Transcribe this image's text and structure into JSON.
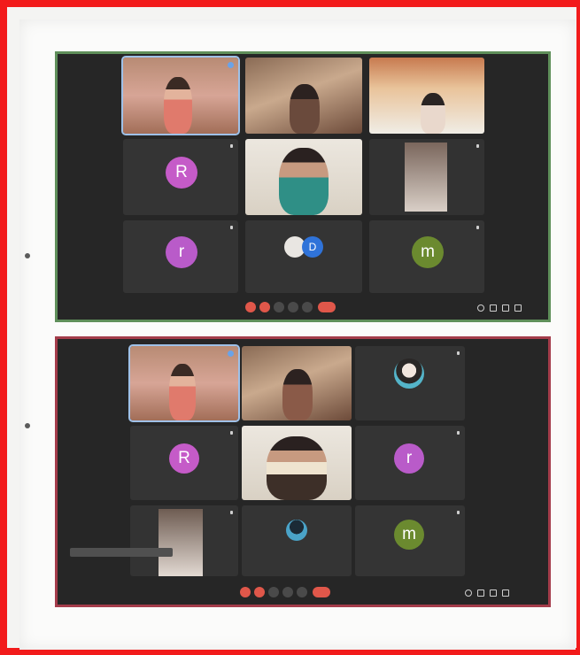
{
  "screenshots": [
    {
      "id": "top",
      "tiles": [
        {
          "name": "",
          "kind": "video-pink",
          "active": true
        },
        {
          "name": "",
          "kind": "video-warm"
        },
        {
          "name": "",
          "kind": "video-banner"
        },
        {
          "name": "",
          "kind": "avatar",
          "letter": "R",
          "color": "#c55bc8"
        },
        {
          "name": "",
          "kind": "video-light"
        },
        {
          "name": "",
          "kind": "video-grey"
        },
        {
          "name": "",
          "kind": "avatar",
          "letter": "r",
          "color": "#b95bc9"
        },
        {
          "name": "",
          "kind": "pair",
          "letter": "D",
          "color": "#2f73d9"
        },
        {
          "name": "",
          "kind": "avatar",
          "letter": "m",
          "color": "#6b8a2f"
        }
      ],
      "bar": {
        "time": "",
        "code": ""
      }
    },
    {
      "id": "bottom",
      "tiles": [
        {
          "name": "",
          "kind": "video-pink",
          "active": true
        },
        {
          "name": "",
          "kind": "video-warm"
        },
        {
          "name": "",
          "kind": "portrait"
        },
        {
          "name": "",
          "kind": "avatar",
          "letter": "R",
          "color": "#c55bc8"
        },
        {
          "name": "",
          "kind": "video-light"
        },
        {
          "name": "",
          "kind": "avatar",
          "letter": "r",
          "color": "#b95bc9"
        },
        {
          "name": "",
          "kind": "video-grey"
        },
        {
          "name": "",
          "kind": "portrait-small"
        },
        {
          "name": "",
          "kind": "avatar",
          "letter": "m",
          "color": "#6b8a2f"
        }
      ],
      "bar": {
        "time": "",
        "code": ""
      },
      "tooltip": ""
    }
  ],
  "colors": {
    "frame": "#f21b1b",
    "top_border": "#5f8f5a",
    "bottom_border": "#a43c4a",
    "meeting_bg": "#262626",
    "end_call": "#e0574a"
  },
  "icons": [
    "mic-icon",
    "camera-icon",
    "captions-icon",
    "present-icon",
    "more-icon",
    "end-call-icon",
    "info-icon",
    "people-icon",
    "chat-icon",
    "activities-icon"
  ]
}
